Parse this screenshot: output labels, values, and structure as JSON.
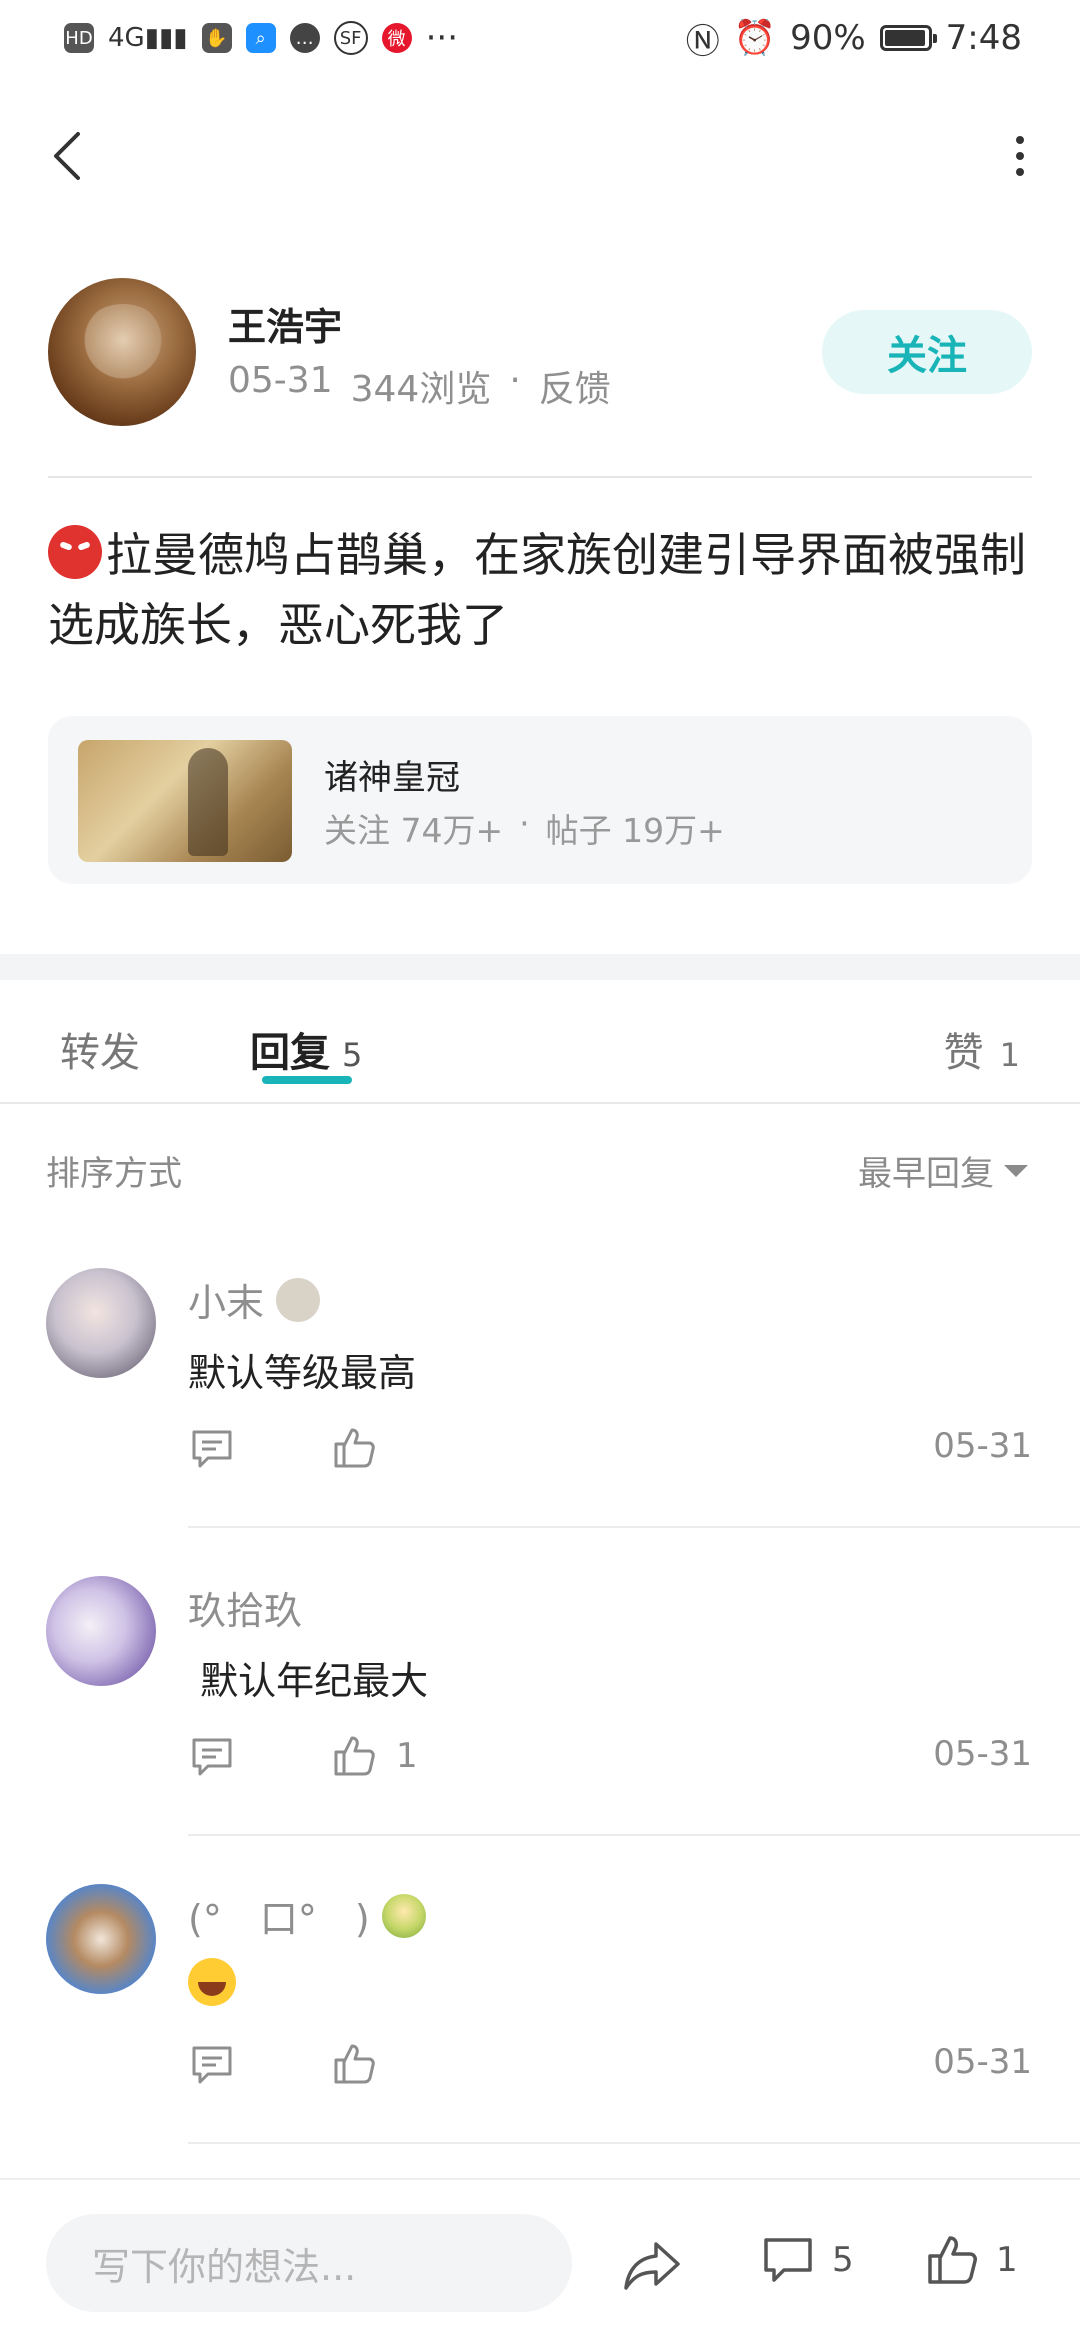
{
  "status_bar": {
    "left_icons": [
      "HD",
      "4G",
      "signal",
      "hand-icon",
      "search-app-icon",
      "chat-icon",
      "sf-icon",
      "weibo-icon",
      "more-dots"
    ],
    "battery_percent": "90%",
    "time": "7:48"
  },
  "author": {
    "name": "王浩宇",
    "date": "05-31",
    "views": "344浏览",
    "dot": "·",
    "feedback": "反馈",
    "follow_label": "关注"
  },
  "post": {
    "text": "拉曼德鸠占鹊巢，在家族创建引导界面被强制选成族长，恶心死我了"
  },
  "forum": {
    "name": "诸神皇冠",
    "follows": "关注 74万+",
    "dot": "·",
    "posts": "帖子 19万+"
  },
  "tabs": {
    "forward_label": "转发",
    "reply_label": "回复",
    "reply_count": "5",
    "like_label": "赞",
    "like_count": "1"
  },
  "sort": {
    "label": "排序方式",
    "selected": "最早回复"
  },
  "comments": [
    {
      "name": "小末",
      "text": "默认等级最高",
      "likes": "",
      "date": "05-31"
    },
    {
      "name": "玖拾玖",
      "text": " 默认年纪最大",
      "likes": "1",
      "date": "05-31"
    },
    {
      "name": "(°　口°　)",
      "text": "",
      "likes": "",
      "date": "05-31"
    }
  ],
  "bottom_bar": {
    "input_placeholder": "写下你的想法...",
    "comment_count": "5",
    "like_count": "1"
  },
  "colors": {
    "accent": "#18b4b8",
    "follow_bg": "#e6f7f7",
    "muted_text": "#8e8e8e"
  }
}
